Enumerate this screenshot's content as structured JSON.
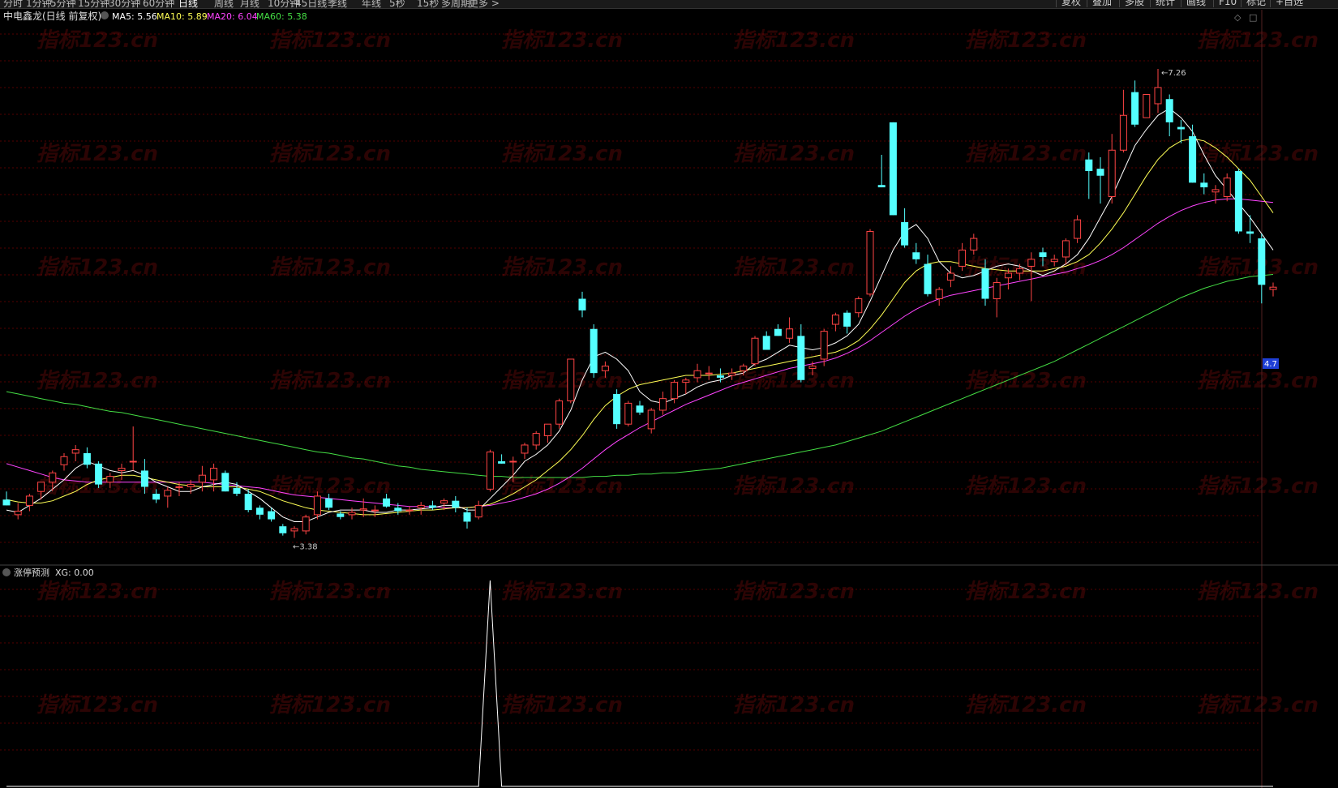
{
  "toolbar": {
    "periods": [
      "分时",
      "1分钟",
      "5分钟",
      "15分钟",
      "30分钟",
      "60分钟",
      "日线",
      "周线",
      "月线",
      "10分钟",
      "45日线",
      "季线",
      "年线",
      "5秒",
      "15秒",
      "多周期",
      "更多 >"
    ],
    "active_period": "日线",
    "right_buttons": [
      "复权",
      "叠加",
      "多股",
      "统计",
      "画线",
      "F10",
      "标记",
      "+自选"
    ]
  },
  "stock": {
    "name": "中电鑫龙",
    "mode": "(日线 前复权)",
    "ma_labels": [
      "MA5: 5.56",
      "MA10: 5.89",
      "MA20: 6.04",
      "MA60: 5.38"
    ]
  },
  "colors": {
    "up": "#ff4444",
    "down": "#54ffff",
    "ma5": "#ffffff",
    "ma10": "#ffff55",
    "ma20": "#ff44ff",
    "ma60": "#44dd44",
    "grid": "#550000",
    "price_tag": "#1f3fd6"
  },
  "indicator": {
    "title": "涨停预测",
    "value_label": "XG: 0.00"
  },
  "annotations": {
    "high": "7.26",
    "low": "3.38",
    "price_tag": "4.7"
  },
  "watermark": "指标123.cn",
  "chart_data": {
    "type": "candlestick",
    "ylim": [
      3.0,
      7.7
    ],
    "columns": [
      "open",
      "high",
      "low",
      "close"
    ],
    "candles": [
      [
        3.55,
        3.62,
        3.5,
        3.5
      ],
      [
        3.42,
        3.52,
        3.38,
        3.45
      ],
      [
        3.5,
        3.6,
        3.45,
        3.58
      ],
      [
        3.62,
        3.7,
        3.55,
        3.7
      ],
      [
        3.7,
        3.8,
        3.62,
        3.78
      ],
      [
        3.85,
        3.95,
        3.8,
        3.92
      ],
      [
        3.95,
        4.02,
        3.88,
        3.98
      ],
      [
        3.95,
        4.0,
        3.82,
        3.85
      ],
      [
        3.86,
        3.88,
        3.65,
        3.68
      ],
      [
        3.7,
        3.78,
        3.65,
        3.75
      ],
      [
        3.8,
        3.86,
        3.72,
        3.82
      ],
      [
        3.88,
        4.18,
        3.8,
        3.88
      ],
      [
        3.8,
        3.9,
        3.6,
        3.66
      ],
      [
        3.6,
        3.64,
        3.52,
        3.55
      ],
      [
        3.58,
        3.66,
        3.48,
        3.63
      ],
      [
        3.66,
        3.7,
        3.58,
        3.66
      ],
      [
        3.66,
        3.72,
        3.6,
        3.68
      ],
      [
        3.7,
        3.84,
        3.62,
        3.76
      ],
      [
        3.72,
        3.86,
        3.62,
        3.82
      ],
      [
        3.78,
        3.8,
        3.62,
        3.62
      ],
      [
        3.65,
        3.7,
        3.58,
        3.6
      ],
      [
        3.6,
        3.64,
        3.44,
        3.46
      ],
      [
        3.48,
        3.5,
        3.38,
        3.42
      ],
      [
        3.45,
        3.48,
        3.36,
        3.38
      ],
      [
        3.32,
        3.34,
        3.24,
        3.26
      ],
      [
        3.28,
        3.32,
        3.22,
        3.3
      ],
      [
        3.28,
        3.42,
        3.25,
        3.4
      ],
      [
        3.42,
        3.62,
        3.38,
        3.58
      ],
      [
        3.56,
        3.6,
        3.46,
        3.48
      ],
      [
        3.43,
        3.45,
        3.38,
        3.4
      ],
      [
        3.42,
        3.48,
        3.38,
        3.44
      ],
      [
        3.46,
        3.56,
        3.4,
        3.47
      ],
      [
        3.46,
        3.5,
        3.4,
        3.46
      ],
      [
        3.56,
        3.6,
        3.48,
        3.49
      ],
      [
        3.48,
        3.52,
        3.42,
        3.45
      ],
      [
        3.46,
        3.49,
        3.42,
        3.46
      ],
      [
        3.48,
        3.53,
        3.42,
        3.5
      ],
      [
        3.5,
        3.54,
        3.46,
        3.48
      ],
      [
        3.52,
        3.56,
        3.46,
        3.54
      ],
      [
        3.54,
        3.58,
        3.44,
        3.48
      ],
      [
        3.44,
        3.48,
        3.3,
        3.36
      ],
      [
        3.4,
        3.54,
        3.38,
        3.5
      ],
      [
        3.64,
        3.98,
        3.62,
        3.96
      ],
      [
        3.88,
        3.94,
        3.86,
        3.86
      ],
      [
        3.88,
        3.92,
        3.7,
        3.88
      ],
      [
        3.95,
        4.04,
        3.9,
        4.02
      ],
      [
        4.02,
        4.14,
        3.98,
        4.12
      ],
      [
        4.1,
        4.2,
        4.04,
        4.2
      ],
      [
        4.2,
        4.42,
        4.16,
        4.4
      ],
      [
        4.4,
        4.76,
        4.38,
        4.76
      ],
      [
        5.28,
        5.34,
        5.12,
        5.18
      ],
      [
        5.02,
        5.06,
        4.6,
        4.64
      ],
      [
        4.66,
        4.74,
        4.6,
        4.7
      ],
      [
        4.46,
        4.5,
        4.16,
        4.2
      ],
      [
        4.2,
        4.4,
        4.18,
        4.38
      ],
      [
        4.36,
        4.4,
        4.28,
        4.3
      ],
      [
        4.16,
        4.34,
        4.12,
        4.32
      ],
      [
        4.32,
        4.48,
        4.28,
        4.42
      ],
      [
        4.42,
        4.58,
        4.38,
        4.56
      ],
      [
        4.56,
        4.6,
        4.46,
        4.58
      ],
      [
        4.6,
        4.72,
        4.56,
        4.66
      ],
      [
        4.64,
        4.7,
        4.58,
        4.64
      ],
      [
        4.62,
        4.68,
        4.56,
        4.6
      ],
      [
        4.62,
        4.68,
        4.58,
        4.64
      ],
      [
        4.66,
        4.72,
        4.62,
        4.7
      ],
      [
        4.72,
        4.96,
        4.7,
        4.94
      ],
      [
        4.96,
        5.0,
        4.84,
        4.84
      ],
      [
        5.02,
        5.06,
        4.96,
        4.96
      ],
      [
        4.94,
        5.12,
        4.9,
        5.02
      ],
      [
        4.96,
        5.06,
        4.56,
        4.58
      ],
      [
        4.68,
        4.74,
        4.62,
        4.7
      ],
      [
        4.76,
        5.02,
        4.7,
        5.0
      ],
      [
        5.06,
        5.16,
        5.0,
        5.14
      ],
      [
        5.16,
        5.18,
        4.98,
        5.04
      ],
      [
        5.16,
        5.3,
        5.12,
        5.28
      ],
      [
        5.32,
        5.88,
        5.3,
        5.86
      ],
      [
        6.26,
        6.52,
        6.24,
        6.24
      ],
      [
        6.8,
        6.8,
        6.0,
        6.0
      ],
      [
        5.94,
        6.06,
        5.72,
        5.74
      ],
      [
        5.68,
        5.76,
        5.58,
        5.62
      ],
      [
        5.58,
        5.66,
        5.3,
        5.32
      ],
      [
        5.28,
        5.38,
        5.22,
        5.36
      ],
      [
        5.44,
        5.56,
        5.38,
        5.5
      ],
      [
        5.56,
        5.76,
        5.52,
        5.7
      ],
      [
        5.7,
        5.84,
        5.66,
        5.8
      ],
      [
        5.54,
        5.62,
        5.22,
        5.28
      ],
      [
        5.28,
        5.46,
        5.12,
        5.42
      ],
      [
        5.46,
        5.54,
        5.36,
        5.5
      ],
      [
        5.5,
        5.58,
        5.44,
        5.54
      ],
      [
        5.56,
        5.68,
        5.26,
        5.62
      ],
      [
        5.68,
        5.72,
        5.56,
        5.64
      ],
      [
        5.6,
        5.66,
        5.56,
        5.62
      ],
      [
        5.64,
        5.8,
        5.58,
        5.78
      ],
      [
        5.8,
        6.0,
        5.76,
        5.96
      ],
      [
        6.48,
        6.54,
        6.14,
        6.38
      ],
      [
        6.4,
        6.5,
        6.1,
        6.34
      ],
      [
        6.16,
        6.7,
        6.1,
        6.56
      ],
      [
        6.56,
        7.08,
        6.54,
        6.86
      ],
      [
        7.06,
        7.16,
        6.76,
        6.78
      ],
      [
        6.84,
        7.04,
        6.86,
        7.04
      ],
      [
        6.96,
        7.26,
        6.88,
        7.1
      ],
      [
        7.0,
        7.04,
        6.68,
        6.8
      ],
      [
        6.76,
        6.82,
        6.62,
        6.74
      ],
      [
        6.68,
        6.78,
        6.28,
        6.28
      ],
      [
        6.28,
        6.36,
        6.18,
        6.24
      ],
      [
        6.2,
        6.26,
        6.1,
        6.22
      ],
      [
        6.16,
        6.36,
        6.12,
        6.32
      ],
      [
        6.38,
        6.4,
        5.84,
        5.86
      ],
      [
        5.86,
        6.0,
        5.76,
        5.84
      ],
      [
        5.8,
        5.84,
        5.24,
        5.4
      ],
      [
        5.36,
        5.42,
        5.3,
        5.38
      ]
    ],
    "ma5": [
      3.46,
      3.44,
      3.5,
      3.56,
      3.64,
      3.72,
      3.82,
      3.88,
      3.84,
      3.8,
      3.78,
      3.8,
      3.76,
      3.7,
      3.66,
      3.62,
      3.62,
      3.66,
      3.68,
      3.7,
      3.68,
      3.62,
      3.56,
      3.48,
      3.4,
      3.36,
      3.36,
      3.4,
      3.44,
      3.46,
      3.46,
      3.46,
      3.44,
      3.44,
      3.46,
      3.46,
      3.47,
      3.48,
      3.5,
      3.5,
      3.46,
      3.46,
      3.56,
      3.66,
      3.76,
      3.88,
      3.94,
      4.02,
      4.14,
      4.32,
      4.58,
      4.78,
      4.82,
      4.76,
      4.66,
      4.48,
      4.4,
      4.38,
      4.42,
      4.46,
      4.52,
      4.56,
      4.58,
      4.62,
      4.64,
      4.72,
      4.76,
      4.82,
      4.88,
      4.86,
      4.84,
      4.86,
      4.9,
      4.96,
      5.06,
      5.26,
      5.48,
      5.7,
      5.86,
      5.92,
      5.8,
      5.6,
      5.5,
      5.46,
      5.48,
      5.52,
      5.56,
      5.58,
      5.56,
      5.52,
      5.48,
      5.52,
      5.58,
      5.66,
      5.8,
      5.98,
      6.16,
      6.38,
      6.6,
      6.74,
      6.86,
      6.92,
      6.84,
      6.72,
      6.52,
      6.34,
      6.22,
      6.1,
      5.98,
      5.84,
      5.7
    ],
    "ma10": [
      3.55,
      3.53,
      3.52,
      3.52,
      3.54,
      3.58,
      3.62,
      3.68,
      3.72,
      3.74,
      3.76,
      3.76,
      3.74,
      3.72,
      3.7,
      3.68,
      3.67,
      3.66,
      3.66,
      3.66,
      3.66,
      3.64,
      3.62,
      3.58,
      3.54,
      3.51,
      3.48,
      3.46,
      3.45,
      3.44,
      3.43,
      3.42,
      3.42,
      3.43,
      3.44,
      3.45,
      3.46,
      3.46,
      3.47,
      3.48,
      3.48,
      3.49,
      3.51,
      3.55,
      3.6,
      3.66,
      3.72,
      3.8,
      3.88,
      3.98,
      4.1,
      4.24,
      4.36,
      4.44,
      4.5,
      4.54,
      4.56,
      4.58,
      4.6,
      4.62,
      4.62,
      4.62,
      4.63,
      4.64,
      4.66,
      4.68,
      4.7,
      4.72,
      4.74,
      4.76,
      4.78,
      4.8,
      4.82,
      4.86,
      4.92,
      5.02,
      5.14,
      5.28,
      5.42,
      5.52,
      5.58,
      5.6,
      5.6,
      5.58,
      5.56,
      5.54,
      5.53,
      5.52,
      5.52,
      5.52,
      5.52,
      5.54,
      5.56,
      5.6,
      5.66,
      5.76,
      5.88,
      6.02,
      6.18,
      6.34,
      6.48,
      6.58,
      6.64,
      6.66,
      6.64,
      6.58,
      6.5,
      6.4,
      6.3,
      6.16,
      6.02
    ],
    "ma20": [
      3.86,
      3.83,
      3.8,
      3.77,
      3.74,
      3.72,
      3.71,
      3.7,
      3.7,
      3.7,
      3.7,
      3.7,
      3.7,
      3.7,
      3.7,
      3.7,
      3.7,
      3.7,
      3.69,
      3.68,
      3.67,
      3.66,
      3.65,
      3.63,
      3.61,
      3.59,
      3.58,
      3.57,
      3.56,
      3.55,
      3.54,
      3.53,
      3.52,
      3.51,
      3.5,
      3.49,
      3.49,
      3.49,
      3.48,
      3.48,
      3.48,
      3.49,
      3.5,
      3.52,
      3.54,
      3.57,
      3.6,
      3.64,
      3.69,
      3.75,
      3.82,
      3.9,
      3.98,
      4.05,
      4.11,
      4.17,
      4.22,
      4.27,
      4.32,
      4.37,
      4.41,
      4.45,
      4.49,
      4.53,
      4.56,
      4.59,
      4.62,
      4.65,
      4.68,
      4.7,
      4.72,
      4.74,
      4.77,
      4.81,
      4.86,
      4.92,
      4.99,
      5.06,
      5.13,
      5.19,
      5.24,
      5.28,
      5.31,
      5.33,
      5.35,
      5.37,
      5.39,
      5.41,
      5.43,
      5.45,
      5.47,
      5.49,
      5.51,
      5.54,
      5.57,
      5.61,
      5.66,
      5.72,
      5.79,
      5.86,
      5.93,
      5.99,
      6.04,
      6.08,
      6.11,
      6.13,
      6.14,
      6.14,
      6.13,
      6.12,
      6.11
    ],
    "ma60": [
      4.48,
      4.46,
      4.44,
      4.42,
      4.4,
      4.38,
      4.37,
      4.35,
      4.33,
      4.31,
      4.3,
      4.28,
      4.26,
      4.24,
      4.22,
      4.2,
      4.18,
      4.16,
      4.14,
      4.12,
      4.1,
      4.08,
      4.06,
      4.04,
      4.02,
      4.0,
      3.98,
      3.96,
      3.95,
      3.93,
      3.91,
      3.9,
      3.88,
      3.86,
      3.84,
      3.83,
      3.81,
      3.8,
      3.79,
      3.78,
      3.77,
      3.76,
      3.75,
      3.75,
      3.74,
      3.74,
      3.74,
      3.74,
      3.74,
      3.74,
      3.74,
      3.75,
      3.75,
      3.76,
      3.76,
      3.77,
      3.77,
      3.78,
      3.78,
      3.79,
      3.8,
      3.81,
      3.82,
      3.84,
      3.86,
      3.88,
      3.9,
      3.92,
      3.94,
      3.96,
      3.98,
      4.0,
      4.02,
      4.05,
      4.08,
      4.11,
      4.14,
      4.18,
      4.22,
      4.26,
      4.3,
      4.34,
      4.38,
      4.42,
      4.46,
      4.5,
      4.54,
      4.58,
      4.62,
      4.66,
      4.7,
      4.74,
      4.79,
      4.84,
      4.89,
      4.94,
      4.99,
      5.04,
      5.09,
      5.14,
      5.19,
      5.24,
      5.29,
      5.33,
      5.37,
      5.4,
      5.43,
      5.45,
      5.47,
      5.48,
      5.49
    ],
    "indicator_spike_index": 42,
    "indicator_range": [
      0,
      1
    ]
  }
}
